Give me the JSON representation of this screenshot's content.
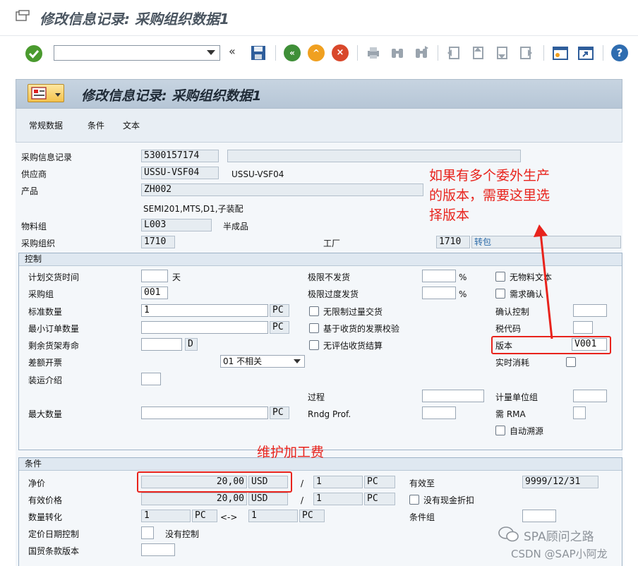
{
  "window": {
    "title": "修改信息记录: 采购组织数据1"
  },
  "screen": {
    "title": "修改信息记录: 采购组织数据1"
  },
  "tabs": [
    {
      "label": "常规数据"
    },
    {
      "label": "条件"
    },
    {
      "label": "文本"
    }
  ],
  "header": {
    "info_record_label": "采购信息记录",
    "info_record_value": "5300157174",
    "vendor_label": "供应商",
    "vendor_value": "USSU-VSF04",
    "vendor_name": "USSU-VSF04",
    "material_label": "产品",
    "material_value": "ZH002",
    "material_desc": "SEMI201,MTS,D1,子装配",
    "matl_group_label": "物料组",
    "matl_group_value": "L003",
    "matl_group_desc": "半成品",
    "purch_org_label": "采购组织",
    "purch_org_value": "1710",
    "plant_label": "工厂",
    "plant_value": "1710",
    "plant_desc": "转包"
  },
  "control": {
    "title": "控制",
    "pdt_label": "计划交货时间",
    "pdt_unit": "天",
    "purch_group_label": "采购组",
    "purch_group_value": "001",
    "std_qty_label": "标准数量",
    "std_qty_value": "1",
    "std_qty_unit": "PC",
    "min_qty_label": "最小订单数量",
    "min_qty_unit": "PC",
    "shelf_life_label": "剩余货架寿命",
    "shelf_life_unit": "D",
    "diff_inv_label": "差额开票",
    "diff_inv_value": "01 不相关",
    "shipping_label": "装运介绍",
    "max_qty_label": "最大数量",
    "max_qty_unit": "PC",
    "under_tol_label": "极限不发货",
    "over_tol_label": "极限过度发货",
    "pct": "%",
    "unlimited_label": "无限制过量交货",
    "gr_iv_label": "基于收货的发票校验",
    "no_ers_label": "无评估收货结算",
    "procedure_label": "过程",
    "rndg_label": "Rndg Prof.",
    "no_text_label": "无物料文本",
    "req_conf_label": "需求确认",
    "conf_ctrl_label": "确认控制",
    "tax_code_label": "税代码",
    "version_label": "版本",
    "version_value": "V001",
    "rt_consump_label": "实时消耗",
    "uom_group_label": "计量单位组",
    "rma_label": "需 RMA",
    "auto_src_label": "自动溯源"
  },
  "conditions": {
    "title": "条件",
    "net_price_label": "净价",
    "net_price_value": "20,00",
    "currency": "USD",
    "per_value": "1",
    "per_unit": "PC",
    "eff_price_label": "有效价格",
    "eff_price_value": "20,00",
    "eff_currency": "USD",
    "eff_per_value": "1",
    "eff_per_unit": "PC",
    "qty_conv_label": "数量转化",
    "qty_conv_left": "1",
    "qty_conv_left_unit": "PC",
    "qty_conv_arrow": "<->",
    "qty_conv_right": "1",
    "qty_conv_right_unit": "PC",
    "price_date_label": "定价日期控制",
    "price_date_text": "没有控制",
    "incoterms_label": "国贸条款版本",
    "valid_to_label": "有效至",
    "valid_to_value": "9999/12/31",
    "no_cash_disc_label": "没有现金折扣",
    "cond_group_label": "条件组",
    "slash": "/"
  },
  "annotations": {
    "version_note_1": "如果有多个委外生产",
    "version_note_2": "的版本，需要这里选",
    "version_note_3": "择版本",
    "price_note": "维护加工费",
    "watermark_1": "SPA顾问之路",
    "watermark_2": "CSDN @SAP小阿龙"
  },
  "colors": {
    "accent_red": "#e8231c",
    "header_bg": "#dfe8f1"
  }
}
